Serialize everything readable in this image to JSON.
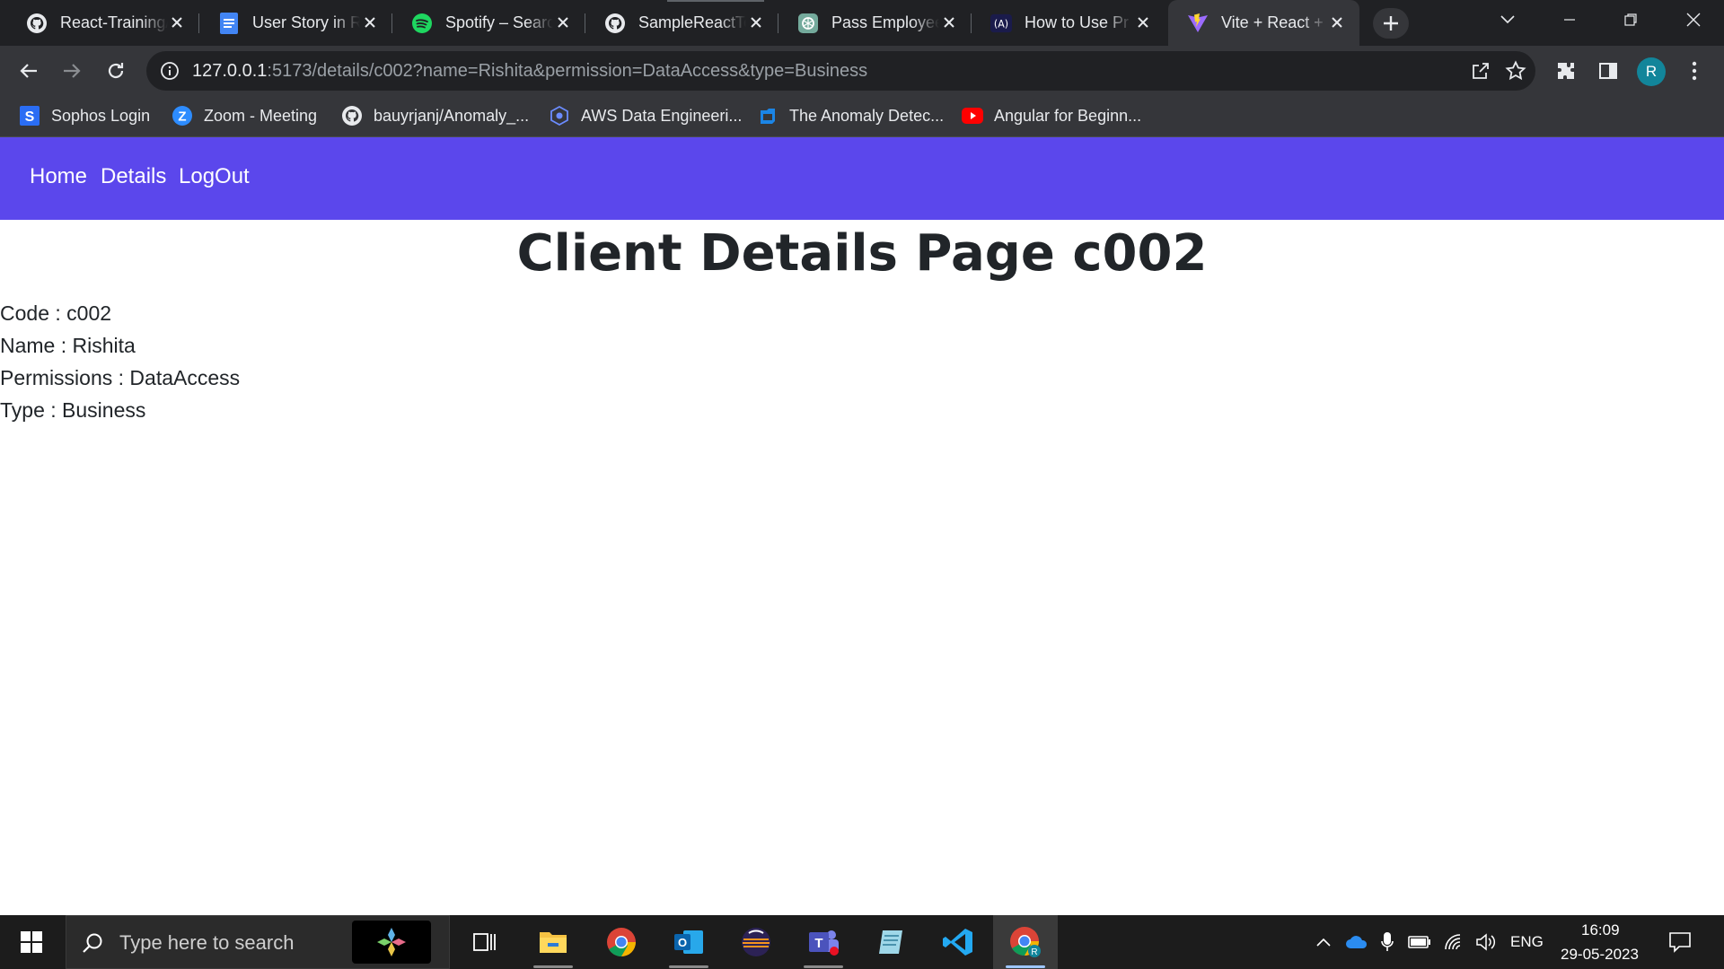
{
  "browser": {
    "tabs": [
      {
        "title": "React-Training/",
        "icon": "github-icon"
      },
      {
        "title": "User Story in R",
        "icon": "docs-icon"
      },
      {
        "title": "Spotify – Search",
        "icon": "spotify-icon"
      },
      {
        "title": "SampleReactTe",
        "icon": "github-icon"
      },
      {
        "title": "Pass Employee",
        "icon": "chatgpt-icon"
      },
      {
        "title": "How to Use Pr",
        "icon": "code-icon"
      },
      {
        "title": "Vite + React +",
        "icon": "vite-icon",
        "active": true
      }
    ],
    "url_host": "127.0.0.1",
    "url_rest": ":5173/details/c002?name=Rishita&permission=DataAccess&type=Business",
    "profile_initial": "R",
    "profile_color": "#12859a",
    "bookmarks": [
      {
        "label": "Sophos Login",
        "icon": "sophos-icon"
      },
      {
        "label": "Zoom - Meeting",
        "icon": "zoom-icon"
      },
      {
        "label": "bauyrjanj/Anomaly_...",
        "icon": "github-icon"
      },
      {
        "label": "AWS Data Engineeri...",
        "icon": "aws-icon"
      },
      {
        "label": "The Anomaly Detec...",
        "icon": "azure-icon"
      },
      {
        "label": "Angular for Beginn...",
        "icon": "youtube-icon"
      }
    ]
  },
  "navbar": {
    "color": "#5b47ec",
    "links": [
      "Home",
      "Details",
      "LogOut"
    ]
  },
  "page": {
    "title": "Client Details Page c002",
    "details": [
      {
        "label": "Code",
        "value": "c002"
      },
      {
        "label": "Name",
        "value": "Rishita"
      },
      {
        "label": "Permissions",
        "value": "DataAccess"
      },
      {
        "label": "Type",
        "value": "Business"
      }
    ],
    "detail_lines": [
      "Code : c002",
      "Name : Rishita",
      "Permissions : DataAccess",
      "Type : Business"
    ]
  },
  "taskbar": {
    "search_placeholder": "Type here to search",
    "apps": [
      "task-view",
      "file-explorer",
      "chrome",
      "outlook",
      "eclipse",
      "teams",
      "notepad",
      "vscode",
      "chrome-profile"
    ],
    "language": "ENG",
    "time": "16:09",
    "date": "29-05-2023"
  }
}
